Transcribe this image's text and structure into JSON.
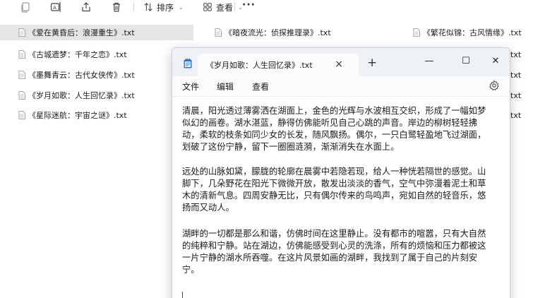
{
  "toolbar": {
    "sort_label": "排序",
    "view_label": "查看",
    "more_label": "···",
    "icons": [
      "copy-icon",
      "rename-icon",
      "share-icon",
      "delete-icon",
      "sort-icon",
      "view-icon"
    ]
  },
  "files": [
    {
      "name": "《爱在黄昏后：浪漫重生》.txt",
      "selected": true
    },
    {
      "name": "《古城遗梦：千年之恋》.txt"
    },
    {
      "name": "《墨舞青云：古代女侠传》.txt"
    },
    {
      "name": "《岁月如歌：人生回忆录》.txt"
    },
    {
      "name": "《星际迷航：宇宙之谜》.txt"
    },
    {
      "name": "《暗夜流光：侦探推理录》.txt"
    },
    {
      "name": "《繁花似锦：古风情缘》.txt"
    },
    {
      "name_partial": "txt"
    },
    {
      "name_partial": "txt"
    },
    {
      "name_partial": "txt"
    },
    {
      "name_partial": "txt"
    }
  ],
  "notepad": {
    "tab_title": "《岁月如歌：人生回忆录》.txt",
    "tab_close": "×",
    "new_tab": "+",
    "window_buttons": {
      "minimize": "—",
      "maximize": "☐",
      "close": "✕"
    },
    "menu": {
      "file": "文件",
      "edit": "编辑",
      "view": "查看"
    },
    "content_lines": [
      "清晨，阳光透过薄雾洒在湖面上，金色的光辉与水波相互交织，形成了一幅如梦",
      "似幻的画卷。湖水湛蓝，静得仿佛能听见自己心跳的声音。岸边的柳树轻轻拂",
      "动，柔软的枝条如同少女的长发，随风飘扬。偶尔，一只白鹭轻盈地飞过湖面，",
      "划破了这份宁静，留下一圈圈涟漪，渐渐消失在水面上。",
      "远处的山脉如黛，朦胧的轮廓在晨雾中若隐若现，给人一种恍若隔世的感觉。山",
      "脚下，几朵野花在阳光下微微开放，散发出淡淡的香气，空气中弥漫着泥土和草",
      "木的清新气息。四周安静无比，只有偶尔传来的鸟鸣声，宛如自然的轻音乐，悠",
      "扬而又动人。",
      "湖畔的一切都是那么和谐，仿佛时间在这里静止。没有都市的喧嚣，只有大自然",
      "的纯粹和宁静。站在湖边，仿佛能感受到心灵的洗涤，所有的烦恼和压力都被这",
      "一片宁静的湖水所吞噬。在这片风景如画的湖畔，我找到了属于自己的片刻安",
      "宁。"
    ]
  },
  "colors": {
    "titlebar": "#eef1f5",
    "selected_row": "#e5e5e5",
    "notepad_icon": "#2d7be0"
  }
}
